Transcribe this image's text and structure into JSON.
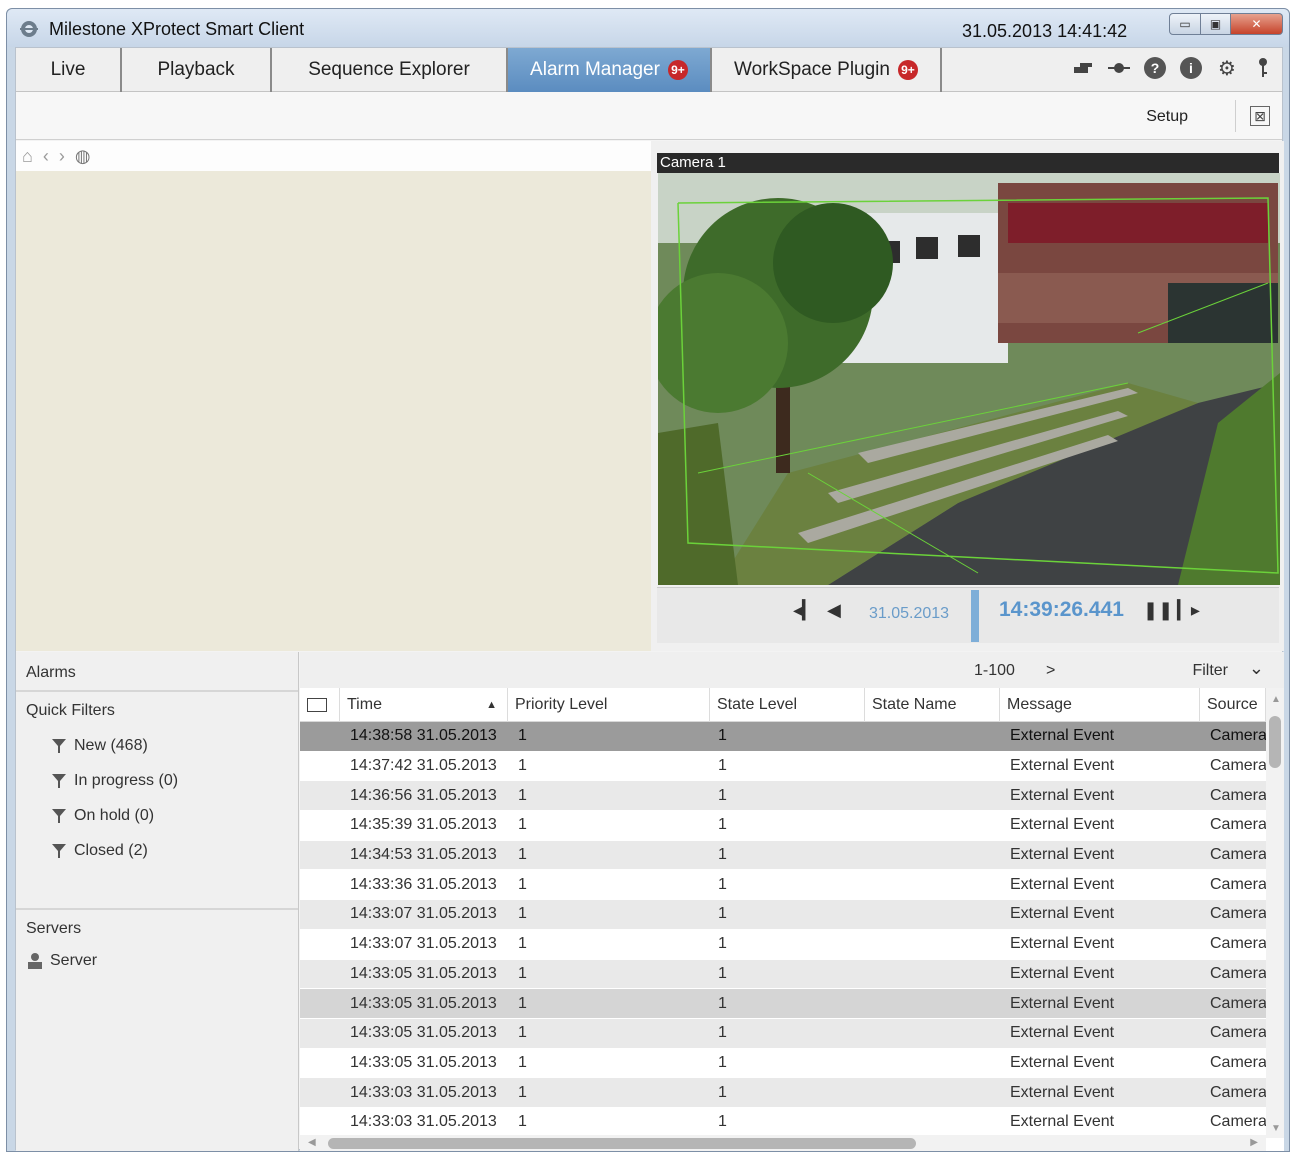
{
  "window": {
    "title": "Milestone XProtect Smart Client",
    "clock": "31.05.2013 14:41:42"
  },
  "tabs": [
    {
      "label": "Live",
      "active": false,
      "badge": ""
    },
    {
      "label": "Playback",
      "active": false,
      "badge": ""
    },
    {
      "label": "Sequence Explorer",
      "active": false,
      "badge": ""
    },
    {
      "label": "Alarm Manager",
      "active": true,
      "badge": "9+"
    },
    {
      "label": "WorkSpace Plugin",
      "active": false,
      "badge": "9+"
    }
  ],
  "toolbar_icons": [
    "switch-icon",
    "pin-icon",
    "help-icon",
    "info-icon",
    "gear-icon",
    "key-icon"
  ],
  "setup": {
    "label": "Setup"
  },
  "camera": {
    "title": "Camera 1",
    "date": "31.05.2013",
    "time": "14:39:26.441"
  },
  "sidebar": {
    "alarms_label": "Alarms",
    "quick_filters_label": "Quick Filters",
    "filters": [
      {
        "label": "New (468)"
      },
      {
        "label": "In progress (0)"
      },
      {
        "label": "On hold (0)"
      },
      {
        "label": "Closed (2)"
      }
    ],
    "servers_label": "Servers",
    "server_item": "Server"
  },
  "list": {
    "range": "1-100",
    "next": ">",
    "filter_label": "Filter",
    "columns": [
      "Time",
      "Priority Level",
      "State Level",
      "State Name",
      "Message",
      "Source"
    ],
    "rows": [
      {
        "time": "14:38:58 31.05.2013",
        "priority": "1",
        "state": "1",
        "state_name": "",
        "message": "External Event",
        "source": "Camera"
      },
      {
        "time": "14:37:42 31.05.2013",
        "priority": "1",
        "state": "1",
        "state_name": "",
        "message": "External Event",
        "source": "Camera"
      },
      {
        "time": "14:36:56 31.05.2013",
        "priority": "1",
        "state": "1",
        "state_name": "",
        "message": "External Event",
        "source": "Camera"
      },
      {
        "time": "14:35:39 31.05.2013",
        "priority": "1",
        "state": "1",
        "state_name": "",
        "message": "External Event",
        "source": "Camera"
      },
      {
        "time": "14:34:53 31.05.2013",
        "priority": "1",
        "state": "1",
        "state_name": "",
        "message": "External Event",
        "source": "Camera"
      },
      {
        "time": "14:33:36 31.05.2013",
        "priority": "1",
        "state": "1",
        "state_name": "",
        "message": "External Event",
        "source": "Camera"
      },
      {
        "time": "14:33:07 31.05.2013",
        "priority": "1",
        "state": "1",
        "state_name": "",
        "message": "External Event",
        "source": "Camera"
      },
      {
        "time": "14:33:07 31.05.2013",
        "priority": "1",
        "state": "1",
        "state_name": "",
        "message": "External Event",
        "source": "Camera"
      },
      {
        "time": "14:33:05 31.05.2013",
        "priority": "1",
        "state": "1",
        "state_name": "",
        "message": "External Event",
        "source": "Camera"
      },
      {
        "time": "14:33:05 31.05.2013",
        "priority": "1",
        "state": "1",
        "state_name": "",
        "message": "External Event",
        "source": "Camera"
      },
      {
        "time": "14:33:05 31.05.2013",
        "priority": "1",
        "state": "1",
        "state_name": "",
        "message": "External Event",
        "source": "Camera"
      },
      {
        "time": "14:33:05 31.05.2013",
        "priority": "1",
        "state": "1",
        "state_name": "",
        "message": "External Event",
        "source": "Camera"
      },
      {
        "time": "14:33:03 31.05.2013",
        "priority": "1",
        "state": "1",
        "state_name": "",
        "message": "External Event",
        "source": "Camera"
      },
      {
        "time": "14:33:03 31.05.2013",
        "priority": "1",
        "state": "1",
        "state_name": "",
        "message": "External Event",
        "source": "Camera"
      }
    ]
  },
  "colors": {
    "active_tab": "#5b8cc0",
    "badge": "#c7282a",
    "timestamp": "#5a95cc",
    "selected_row": "#9b9b9b"
  }
}
